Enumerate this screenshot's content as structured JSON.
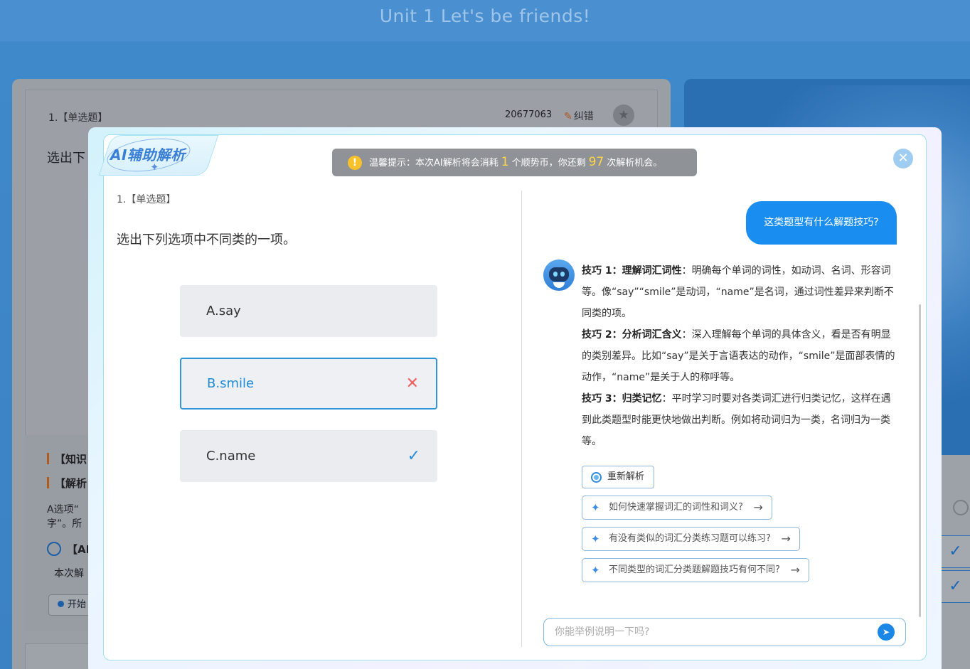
{
  "page": {
    "title": "Unit 1 Let's be friends!"
  },
  "background": {
    "question_number": "1.【单选题】",
    "question_id": "20677063",
    "fix_label": "纠错",
    "question_text_partial": "选出下",
    "section_knowledge": "【知识",
    "section_analysis": "【解析",
    "analysis_partial_1": "A选项“",
    "analysis_partial_2": "字”。所",
    "section_ai": "【AI",
    "ai_partial": "本次解",
    "start_button_partial": "开始"
  },
  "modal": {
    "logo": "AI辅助解析",
    "notice": {
      "prefix": "温馨提示：本次AI解析将会消耗",
      "cost": "1",
      "middle": "个顺势币，你还剩",
      "remaining": "97",
      "suffix": "次解析机会。"
    },
    "question": {
      "number": "1.【单选题】",
      "text": "选出下列选项中不同类的一项。",
      "options": [
        {
          "label": "A.say",
          "state": "normal"
        },
        {
          "label": "B.smile",
          "state": "wrong"
        },
        {
          "label": "C.name",
          "state": "correct"
        }
      ]
    },
    "chat": {
      "user_message": "这类题型有什么解题技巧?",
      "tips": [
        {
          "title": "技巧 1：理解词汇词性",
          "body": "：明确每个单词的词性，如动词、名词、形容词等。像“say”“smile”是动词，“name”是名词，通过词性差异来判断不同类的项。"
        },
        {
          "title": "技巧 2：分析词汇含义",
          "body": "：深入理解每个单词的具体含义，看是否有明显的类别差异。比如“say”是关于言语表达的动作，“smile”是面部表情的动作，“name”是关于人的称呼等。"
        },
        {
          "title": "技巧 3：归类记忆",
          "body": "：平时学习时要对各类词汇进行归类记忆，这样在遇到此类题型时能更快地做出判断。例如将动词归为一类，名词归为一类等。"
        }
      ],
      "reparse_label": "重新解析",
      "suggestions": [
        "如何快速掌握词汇的词性和词义?",
        "有没有类似的词汇分类练习题可以练习?",
        "不同类型的词汇分类题解题技巧有何不同?"
      ],
      "input_placeholder": "你能举例说明一下吗?"
    }
  }
}
